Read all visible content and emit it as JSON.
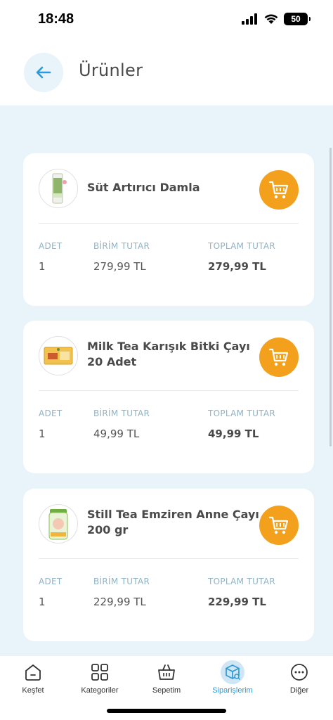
{
  "status": {
    "time": "18:48",
    "battery": "50"
  },
  "header": {
    "title": "Ürünler"
  },
  "columns": {
    "qty": "ADET",
    "unit": "BİRİM TUTAR",
    "total": "TOPLAM TUTAR"
  },
  "products": [
    {
      "name": "Süt Artırıcı Damla",
      "qty": "1",
      "unit_price": "279,99 TL",
      "total_price": "279,99 TL"
    },
    {
      "name": "Milk Tea Karışık Bitki Çayı 20 Adet",
      "qty": "1",
      "unit_price": "49,99 TL",
      "total_price": "49,99 TL"
    },
    {
      "name": "Still Tea Emziren Anne Çayı 200 gr",
      "qty": "1",
      "unit_price": "229,99 TL",
      "total_price": "229,99 TL"
    }
  ],
  "nav": [
    {
      "label": "Keşfet",
      "icon": "home-icon"
    },
    {
      "label": "Kategoriler",
      "icon": "grid-icon"
    },
    {
      "label": "Sepetim",
      "icon": "basket-icon"
    },
    {
      "label": "Siparişlerim",
      "icon": "orders-box-icon",
      "active": true
    },
    {
      "label": "Diğer",
      "icon": "more-icon"
    }
  ],
  "colors": {
    "accent": "#2d9ad8",
    "cart": "#f3a01c",
    "background": "#e8f3fa"
  }
}
